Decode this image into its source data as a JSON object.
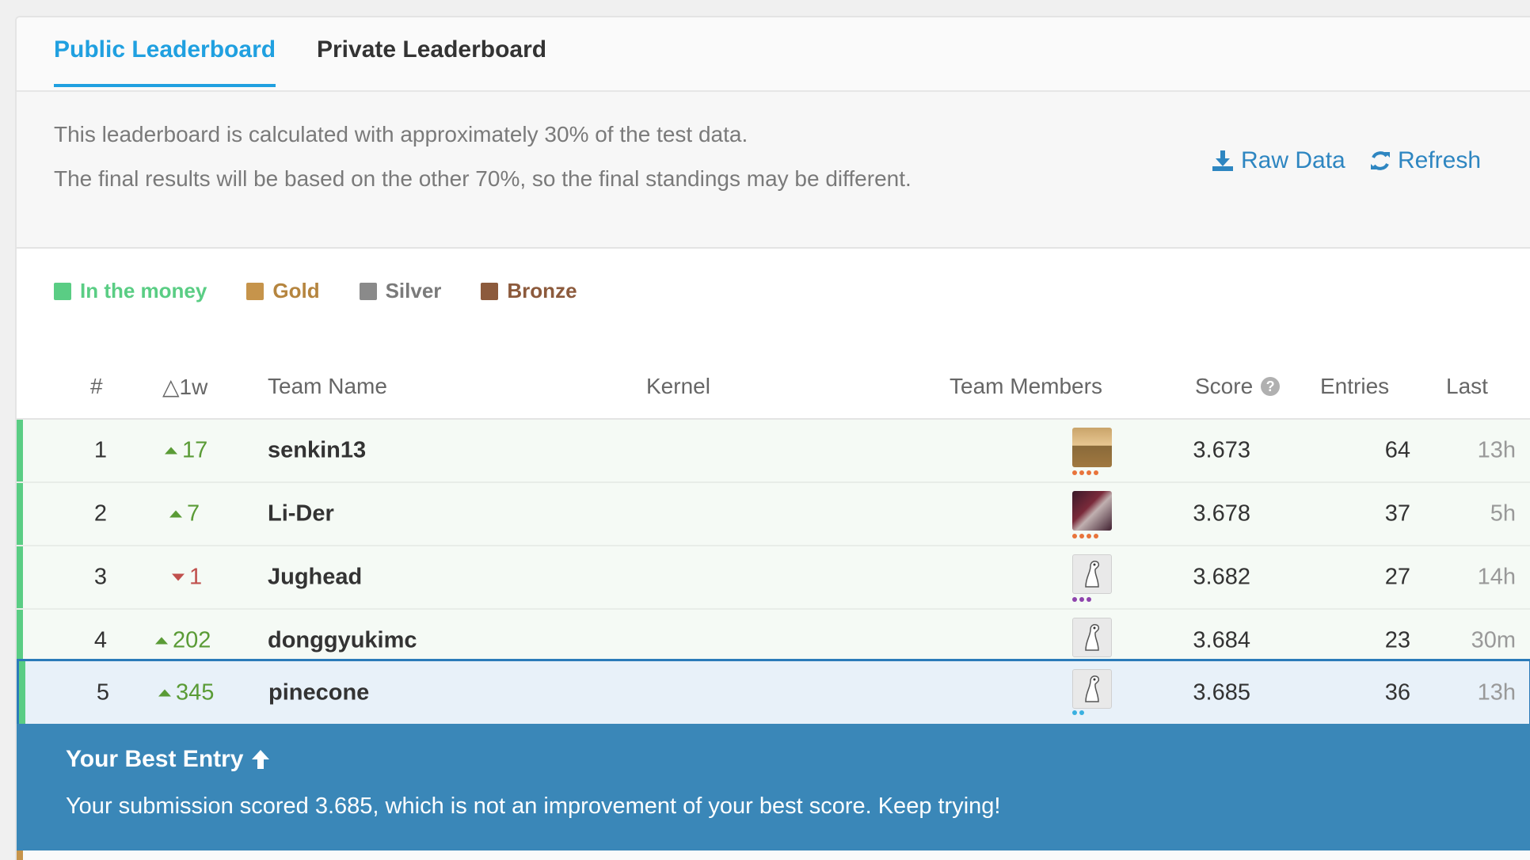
{
  "tabs": [
    {
      "label": "Public Leaderboard",
      "active": true
    },
    {
      "label": "Private Leaderboard",
      "active": false
    }
  ],
  "info": {
    "line1": "This leaderboard is calculated with approximately 30% of the test data.",
    "line2": "The final results will be based on the other 70%, so the final standings may be different.",
    "raw_data_label": "Raw Data",
    "refresh_label": "Refresh"
  },
  "legend": [
    {
      "label": "In the money",
      "color": "#5acd84"
    },
    {
      "label": "Gold",
      "color": "#c6944b"
    },
    {
      "label": "Silver",
      "color": "#8a8a8a"
    },
    {
      "label": "Bronze",
      "color": "#8c5a3c"
    }
  ],
  "columns": {
    "rank": "#",
    "delta": "△1w",
    "team": "Team Name",
    "kernel": "Kernel",
    "members": "Team Members",
    "score": "Score",
    "entries": "Entries",
    "last": "Last"
  },
  "rows": [
    {
      "rank": "1",
      "delta": "17",
      "direction": "up",
      "team": "senkin13",
      "score": "3.673",
      "entries": "64",
      "last": "13h",
      "avatar": "photo-desert",
      "dot_color": "#e8743b",
      "dot_count": 4
    },
    {
      "rank": "2",
      "delta": "7",
      "direction": "up",
      "team": "Li-Der",
      "score": "3.678",
      "entries": "37",
      "last": "5h",
      "avatar": "photo-person",
      "dot_color": "#e8743b",
      "dot_count": 4
    },
    {
      "rank": "3",
      "delta": "1",
      "direction": "down",
      "team": "Jughead",
      "score": "3.682",
      "entries": "27",
      "last": "14h",
      "avatar": "goose-icon",
      "dot_color": "#8e44ad",
      "dot_count": 3
    },
    {
      "rank": "4",
      "delta": "202",
      "direction": "up",
      "team": "donggyukimc",
      "score": "3.684",
      "entries": "23",
      "last": "30m",
      "avatar": "goose-icon",
      "dot_color": "#5acd84",
      "dot_count": 1
    },
    {
      "rank": "5",
      "delta": "345",
      "direction": "up",
      "team": "pinecone",
      "score": "3.685",
      "entries": "36",
      "last": "13h",
      "avatar": "goose-icon",
      "dot_color": "#3ab0e0",
      "dot_count": 2
    }
  ],
  "banner": {
    "title": "Your Best Entry",
    "message": "Your submission scored 3.685, which is not an improvement of your best score. Keep trying!"
  }
}
